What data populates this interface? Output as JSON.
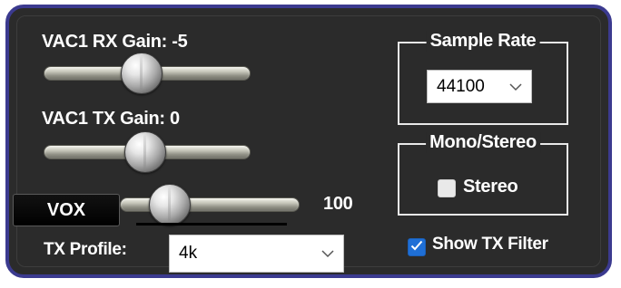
{
  "vac1_rx": {
    "label": "VAC1 RX Gain: -5",
    "value": -5
  },
  "vac1_tx": {
    "label": "VAC1 TX Gain: 0",
    "value": 0
  },
  "vox": {
    "button_label": "VOX",
    "value_text": "100"
  },
  "tx_profile": {
    "label": "TX Profile:",
    "selected": "4k"
  },
  "sample_rate": {
    "legend": "Sample Rate",
    "selected": "44100"
  },
  "mono_stereo": {
    "legend": "Mono/Stereo",
    "stereo_label": "Stereo",
    "stereo_checked": false
  },
  "show_tx_filter": {
    "label": "Show TX Filter",
    "checked": true
  },
  "icons": {
    "dropdown": "chevron-down-icon",
    "check": "checkmark-icon"
  }
}
